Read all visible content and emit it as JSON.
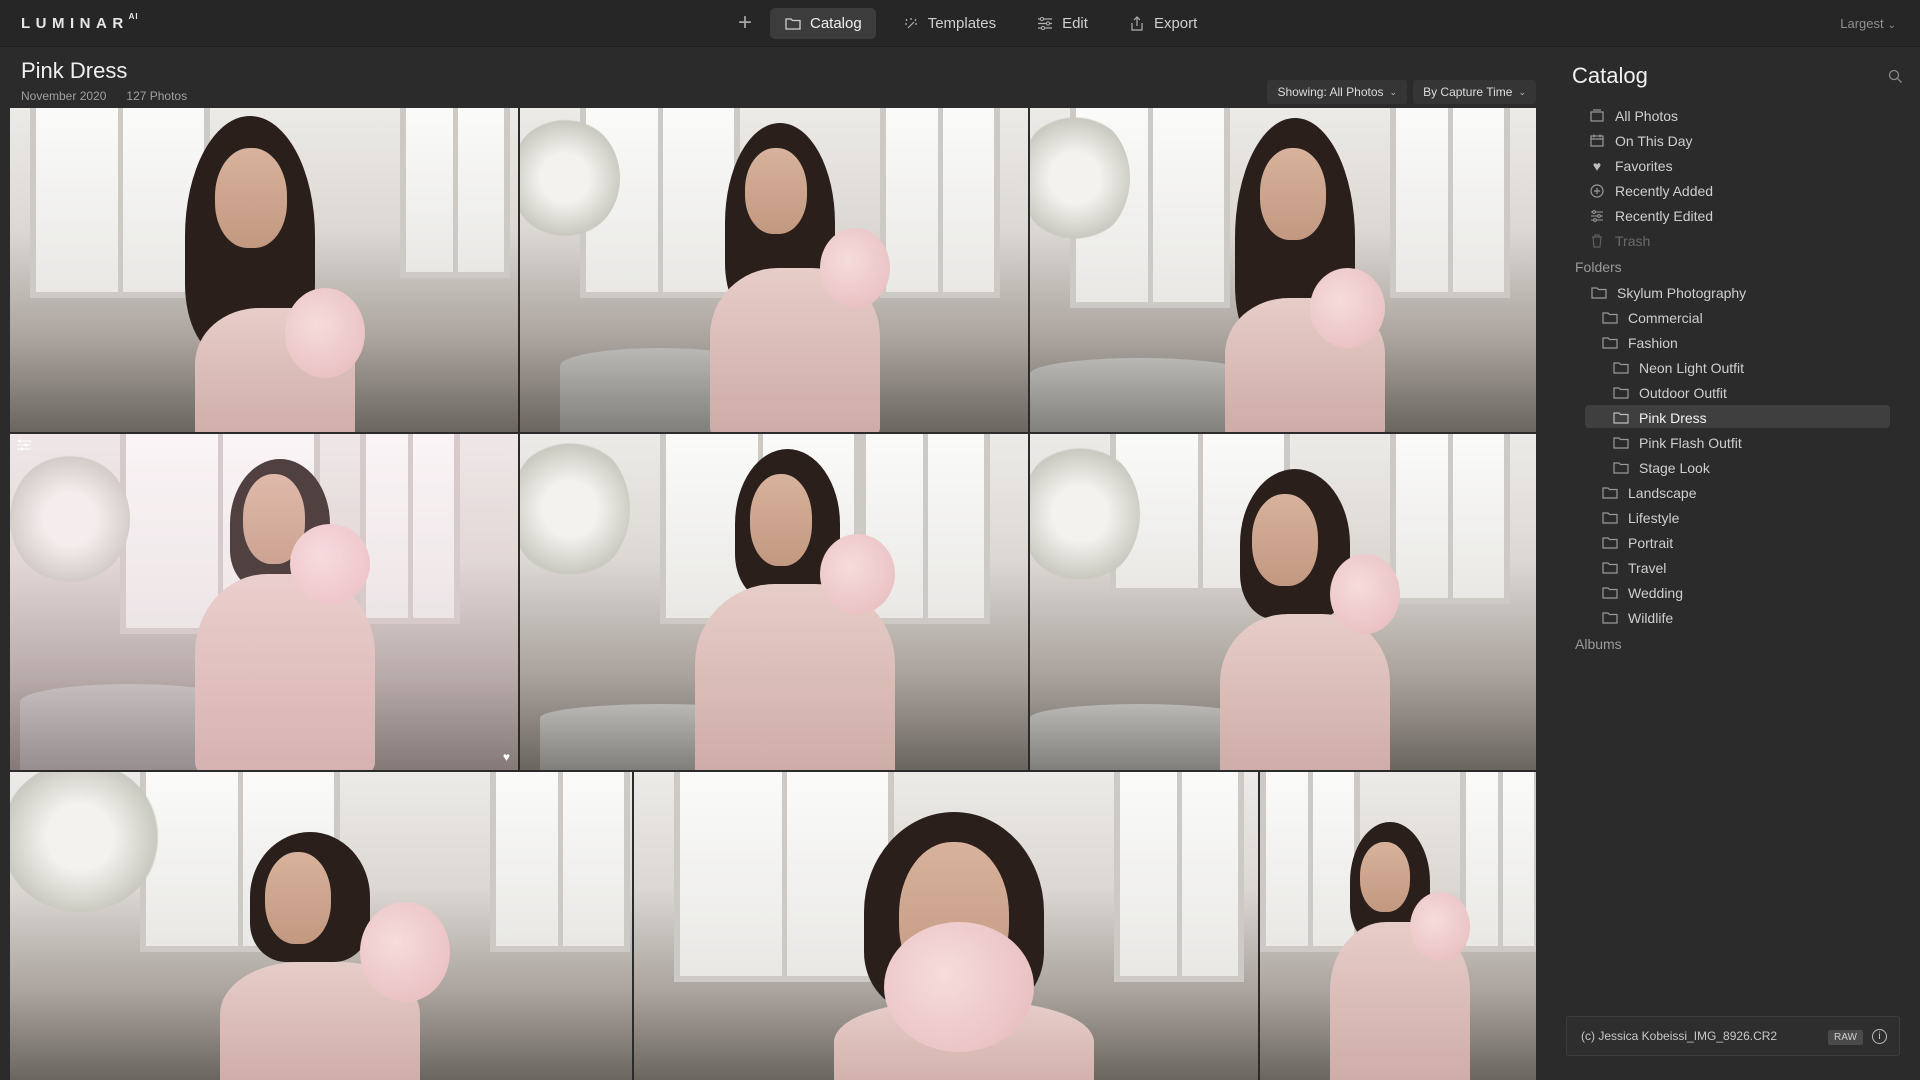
{
  "app": {
    "logo": "LUMINAR",
    "logo_suffix": "AI"
  },
  "topnav": {
    "add_icon": "plus-icon",
    "tabs": [
      {
        "label": "Catalog",
        "icon": "folder-icon",
        "active": true
      },
      {
        "label": "Templates",
        "icon": "sparkle-icon",
        "active": false
      },
      {
        "label": "Edit",
        "icon": "sliders-icon",
        "active": false
      },
      {
        "label": "Export",
        "icon": "share-icon",
        "active": false
      }
    ],
    "size_label": "Largest"
  },
  "album": {
    "title": "Pink Dress",
    "date": "November 2020",
    "count": "127 Photos"
  },
  "filters": {
    "showing": "Showing: All Photos",
    "sort": "By Capture Time"
  },
  "grid": {
    "selected_index": 3,
    "favorite_index": 3
  },
  "sidebar": {
    "title": "Catalog",
    "shortcuts": [
      {
        "label": "All Photos",
        "icon": "photos-icon"
      },
      {
        "label": "On This Day",
        "icon": "calendar-icon"
      },
      {
        "label": "Favorites",
        "icon": "heart-icon"
      },
      {
        "label": "Recently Added",
        "icon": "plus-circle-icon"
      },
      {
        "label": "Recently Edited",
        "icon": "sliders-icon"
      },
      {
        "label": "Trash",
        "icon": "trash-icon"
      }
    ],
    "folders_header": "Folders",
    "folders": [
      {
        "label": "Skylum Photography",
        "level": 0
      },
      {
        "label": "Commercial",
        "level": 1
      },
      {
        "label": "Fashion",
        "level": 1
      },
      {
        "label": "Neon Light Outfit",
        "level": 2
      },
      {
        "label": "Outdoor Outfit",
        "level": 2
      },
      {
        "label": "Pink Dress",
        "level": 2,
        "selected": true
      },
      {
        "label": "Pink Flash Outfit",
        "level": 2
      },
      {
        "label": "Stage Look",
        "level": 2
      },
      {
        "label": "Landscape",
        "level": 1
      },
      {
        "label": "Lifestyle",
        "level": 1
      },
      {
        "label": "Portrait",
        "level": 1
      },
      {
        "label": "Travel",
        "level": 1
      },
      {
        "label": "Wedding",
        "level": 1
      },
      {
        "label": "Wildlife",
        "level": 1
      }
    ],
    "albums_header": "Albums",
    "file_name": "(c) Jessica Kobeissi_IMG_8926.CR2",
    "file_badge": "RAW"
  },
  "colors": {
    "selection_outline": "#5bb8e0",
    "background": "#2b2b2b"
  }
}
